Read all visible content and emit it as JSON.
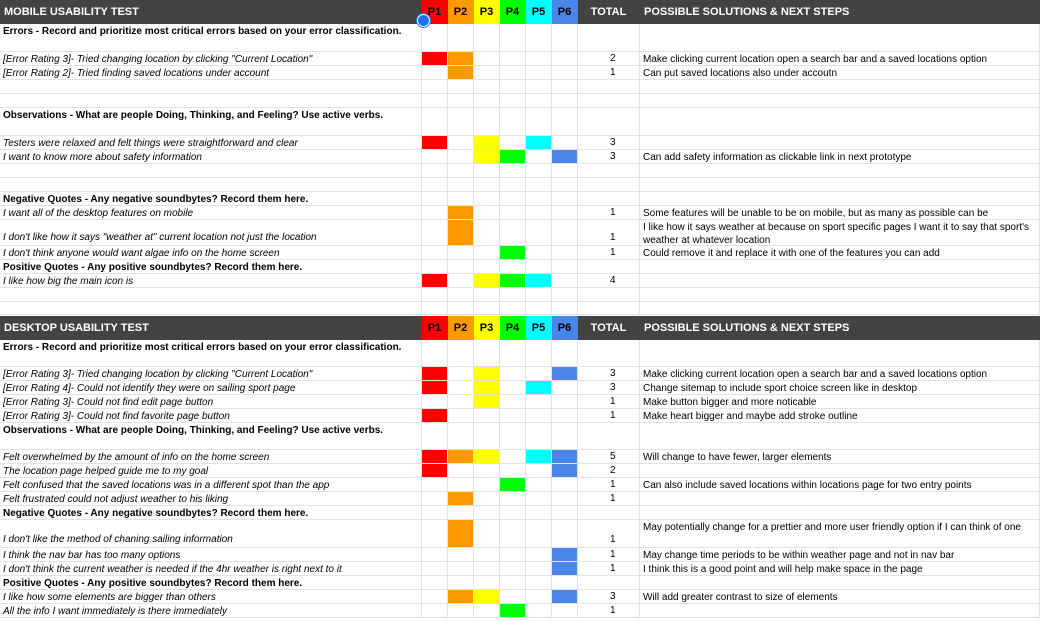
{
  "colors": {
    "P1": "#ff0000",
    "P2": "#ff9900",
    "P3": "#ffff00",
    "P4": "#00ff00",
    "P5": "#00ffff",
    "P6": "#4a86e8",
    "header_bg": "#434343"
  },
  "sections": [
    {
      "title": "MOBILE USABILITY TEST",
      "participants": [
        "P1",
        "P2",
        "P3",
        "P4",
        "P5",
        "P6"
      ],
      "total_label": "TOTAL",
      "solutions_label": "POSSIBLE SOLUTIONS & NEXT STEPS",
      "rows": [
        {
          "text": "Errors - Record and prioritize most critical errors based on your error classification.",
          "bold": true,
          "h": 28
        },
        {
          "text": "[Error Rating 3]- Tried changing location by clicking \"Current Location\"",
          "italic": true,
          "marks": [
            "P1",
            "P2"
          ],
          "total": "2",
          "solution": "Make clicking current location open a search bar and a saved locations option",
          "h": 14
        },
        {
          "text": "[Error Rating 2]- Tried finding saved locations under account",
          "italic": true,
          "marks": [
            "P2"
          ],
          "total": "1",
          "solution": "Can put saved locations also under accoutn",
          "h": 14
        },
        {
          "text": "",
          "h": 14
        },
        {
          "text": "",
          "h": 14
        },
        {
          "text": "Observations - What are people Doing, Thinking, and Feeling? Use active verbs.",
          "bold": true,
          "h": 28
        },
        {
          "text": "Testers were relaxed and felt things were straightforward and clear",
          "italic": true,
          "marks": [
            "P1",
            "P3",
            "P5"
          ],
          "total": "3",
          "solution": "",
          "h": 14
        },
        {
          "text": "I want to know more about safety information",
          "italic": true,
          "marks": [
            "P3",
            "P4",
            "P6"
          ],
          "total": "3",
          "solution": "Can add safety information as clickable link in next prototype",
          "h": 14
        },
        {
          "text": "",
          "h": 14
        },
        {
          "text": "",
          "h": 14
        },
        {
          "text": "Negative Quotes - Any negative soundbytes? Record them here.",
          "bold": true,
          "h": 14
        },
        {
          "text": "I want all of the desktop features on mobile",
          "italic": true,
          "marks": [
            "P2"
          ],
          "total": "1",
          "solution": "Some features will be unable to be on mobile, but as many as possible can be",
          "h": 14
        },
        {
          "text": "I don't like how it says \"weather at\" current location not just the location",
          "italic": true,
          "marks": [
            "P2"
          ],
          "total": "1",
          "solution": "I like how it says weather at because on sport specific pages I want it to say that sport's weather at whatever location",
          "h": 26,
          "align": "bottom"
        },
        {
          "text": "I don't think anyone would want algae info on the home screen",
          "italic": true,
          "marks": [
            "P4"
          ],
          "total": "1",
          "solution": "Could remove it and replace it with one of the features you can add",
          "h": 14
        },
        {
          "text": "Positive Quotes - Any positive soundbytes? Record them here.",
          "bold": true,
          "h": 14
        },
        {
          "text": "I like how big the main icon is",
          "italic": true,
          "marks": [
            "P1",
            "P3",
            "P4",
            "P5"
          ],
          "total": "4",
          "solution": "",
          "h": 14
        },
        {
          "text": "",
          "h": 14
        },
        {
          "text": "",
          "h": 13
        }
      ]
    },
    {
      "title": "DESKTOP USABILITY TEST",
      "participants": [
        "P1",
        "P2",
        "P3",
        "P4",
        "P5",
        "P6"
      ],
      "total_label": "TOTAL",
      "solutions_label": "POSSIBLE SOLUTIONS & NEXT STEPS",
      "rows": [
        {
          "text": "Errors - Record and prioritize most critical errors based on your error classification.",
          "bold": true,
          "h": 27
        },
        {
          "text": "[Error Rating 3]- Tried changing location by clicking \"Current Location\"",
          "italic": true,
          "marks": [
            "P1",
            "P3",
            "P6"
          ],
          "total": "3",
          "solution": "Make clicking current location open a search bar and a saved locations option",
          "h": 14
        },
        {
          "text": "[Error Rating 4]- Could not identify they were on sailing sport page",
          "italic": true,
          "marks": [
            "P1",
            "P3",
            "P5"
          ],
          "total": "3",
          "solution": "Change sitemap to include sport choice screen like in desktop",
          "h": 14
        },
        {
          "text": "[Error Rating 3]- Could not find edit page button",
          "italic": true,
          "marks": [
            "P3"
          ],
          "total": "1",
          "solution": "Make button bigger and more noticable",
          "h": 14
        },
        {
          "text": "[Error Rating 3]- Could not find favorite page button",
          "italic": true,
          "marks": [
            "P1"
          ],
          "total": "1",
          "solution": "Make heart bigger and maybe add stroke outline",
          "h": 14
        },
        {
          "text": "Observations - What are people Doing, Thinking, and Feeling? Use active verbs.",
          "bold": true,
          "h": 27
        },
        {
          "text": "Felt overwhelmed by the amount of info on the home screen",
          "italic": true,
          "marks": [
            "P1",
            "P2",
            "P3",
            "P5",
            "P6"
          ],
          "total": "5",
          "solution": "Will change to have fewer, larger elements",
          "h": 14
        },
        {
          "text": "The location page helped guide me to my goal",
          "italic": true,
          "marks": [
            "P1",
            "P6"
          ],
          "total": "2",
          "solution": "",
          "h": 14
        },
        {
          "text": "Felt confused that the saved locations was in a different spot than the app",
          "italic": true,
          "marks": [
            "P4"
          ],
          "total": "1",
          "solution": "Can also include saved locations within locations page for two entry points",
          "h": 14
        },
        {
          "text": "Felt frustrated could not adjust weather to his liking",
          "italic": true,
          "marks": [
            "P2"
          ],
          "total": "1",
          "solution": "",
          "h": 14
        },
        {
          "text": "Negative Quotes - Any negative soundbytes? Record them here.",
          "bold": true,
          "h": 14
        },
        {
          "text": "I don't like the method of chaning sailing information",
          "italic": true,
          "marks": [
            "P2"
          ],
          "total": "1",
          "solution": "May potentially change for a prettier and more user friendly option if I can think of one",
          "h": 28,
          "align": "bottom"
        },
        {
          "text": "I think the nav bar has too many options",
          "italic": true,
          "marks": [
            "P6"
          ],
          "total": "1",
          "solution": "May change time periods to be within weather page and not in nav bar",
          "h": 14
        },
        {
          "text": "I don't think the current weather is needed if the 4hr weather is right next to it",
          "italic": true,
          "marks": [
            "P6"
          ],
          "total": "1",
          "solution": "I think this is a good point and will help make space in the page",
          "h": 14
        },
        {
          "text": "Positive Quotes - Any positive soundbytes? Record them here.",
          "bold": true,
          "h": 14
        },
        {
          "text": "I like how some elements are bigger than others",
          "italic": true,
          "marks": [
            "P2",
            "P3",
            "P6"
          ],
          "total": "3",
          "solution": "Will add greater contrast to size of elements",
          "h": 14
        },
        {
          "text": "All the info I want immediately is there immediately",
          "italic": true,
          "marks": [
            "P4"
          ],
          "total": "1",
          "solution": "",
          "h": 14
        }
      ]
    }
  ]
}
